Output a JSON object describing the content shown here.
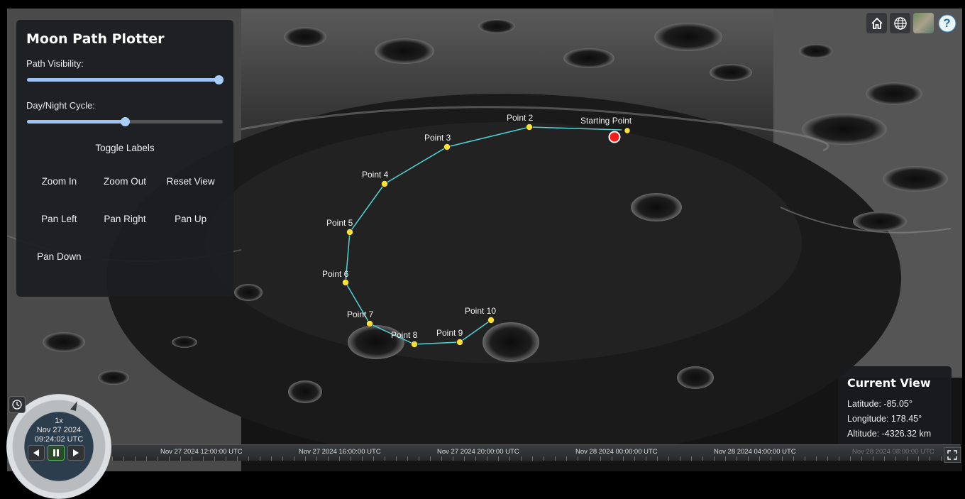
{
  "panel": {
    "title": "Moon Path Plotter",
    "path_visibility_label": "Path Visibility:",
    "path_visibility_value": 1.0,
    "day_night_label": "Day/Night Cycle:",
    "day_night_value": 0.5,
    "toggle_labels": "Toggle Labels",
    "buttons": [
      "Zoom In",
      "Zoom Out",
      "Reset View",
      "Pan Left",
      "Pan Right",
      "Pan Up",
      "Pan Down"
    ]
  },
  "path": {
    "line_color": "#4fd3d6",
    "point_color": "#ffe135",
    "start_color": "#ff1a1a",
    "labels": {
      "start": "Starting Point",
      "p2": "Point 2",
      "p3": "Point 3",
      "p4": "Point 4",
      "p5": "Point 5",
      "p6": "Point 6",
      "p7": "Point 7",
      "p8": "Point 8",
      "p9": "Point 9",
      "p10": "Point 10"
    }
  },
  "toolbar": {
    "icons": [
      "home-icon",
      "globe-icon",
      "imagery-layer-icon",
      "help-icon"
    ],
    "help_glyph": "?"
  },
  "current_view": {
    "title": "Current View",
    "latitude": "Latitude: -85.05°",
    "longitude": "Longitude: 178.45°",
    "altitude": "Altitude: -4326.32 km"
  },
  "animation": {
    "speed": "1x",
    "date": "Nov 27 2024",
    "time": "09:24:02 UTC"
  },
  "timeline": {
    "labels": [
      "Nov 27 2024 12:00:00 UTC",
      "Nov 27 2024 16:00:00 UTC",
      "Nov 27 2024 20:00:00 UTC",
      "Nov 28 2024 00:00:00 UTC",
      "Nov 28 2024 04:00:00 UTC",
      "Nov 28 2024 08:00:00 UTC"
    ]
  }
}
